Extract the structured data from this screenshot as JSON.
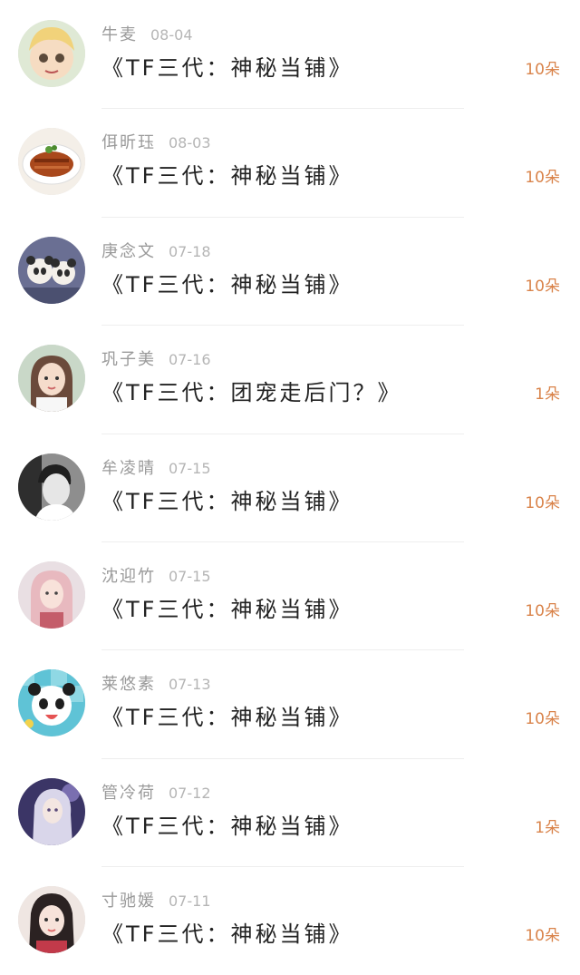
{
  "colors": {
    "name": "#9a9a9a",
    "date": "#b5b5b5",
    "title": "#222222",
    "gift": "#d9834a",
    "separator": "#eeeeee"
  },
  "items": [
    {
      "name": "牛麦",
      "date": "08-04",
      "title": "《TF三代：神秘当铺》",
      "gift": "10朵",
      "avatar": "cartoon-boy-avatar"
    },
    {
      "name": "佴昕珏",
      "date": "08-03",
      "title": "《TF三代：神秘当铺》",
      "gift": "10朵",
      "avatar": "braised-pork-avatar"
    },
    {
      "name": "庚念文",
      "date": "07-18",
      "title": "《TF三代：神秘当铺》",
      "gift": "10朵",
      "avatar": "panda-toys-avatar"
    },
    {
      "name": "巩子美",
      "date": "07-16",
      "title": "《TF三代：团宠走后门？》",
      "gift": "1朵",
      "avatar": "girl-photo-avatar"
    },
    {
      "name": "牟凌晴",
      "date": "07-15",
      "title": "《TF三代：神秘当铺》",
      "gift": "10朵",
      "avatar": "bw-boy-avatar"
    },
    {
      "name": "沈迎竹",
      "date": "07-15",
      "title": "《TF三代：神秘当铺》",
      "gift": "10朵",
      "avatar": "pink-hair-girl-avatar"
    },
    {
      "name": "莱悠素",
      "date": "07-13",
      "title": "《TF三代：神秘当铺》",
      "gift": "10朵",
      "avatar": "cartoon-panda-avatar"
    },
    {
      "name": "管冷荷",
      "date": "07-12",
      "title": "《TF三代：神秘当铺》",
      "gift": "1朵",
      "avatar": "anime-girl-avatar"
    },
    {
      "name": "寸驰媛",
      "date": "07-11",
      "title": "《TF三代：神秘当铺》",
      "gift": "10朵",
      "avatar": "selfie-girl-avatar"
    }
  ]
}
